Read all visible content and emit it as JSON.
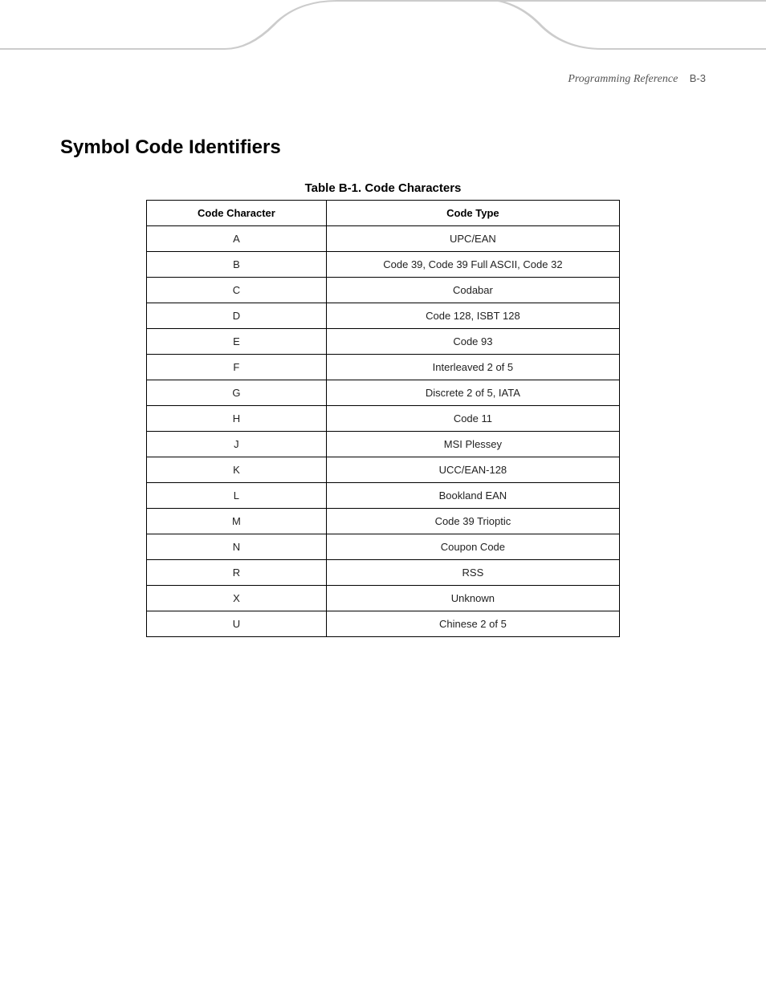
{
  "header": {
    "section": "Programming Reference",
    "page": "B-3"
  },
  "title": "Symbol Code Identifiers",
  "table_title": "Table B-1.  Code Characters",
  "columns": [
    "Code Character",
    "Code Type"
  ],
  "chart_data": {
    "type": "table",
    "title": "Code Characters",
    "columns": [
      "Code Character",
      "Code Type"
    ],
    "rows": [
      {
        "char": "A",
        "type": "UPC/EAN"
      },
      {
        "char": "B",
        "type": "Code 39, Code 39 Full ASCII, Code 32"
      },
      {
        "char": "C",
        "type": "Codabar"
      },
      {
        "char": "D",
        "type": "Code 128, ISBT 128"
      },
      {
        "char": "E",
        "type": "Code 93"
      },
      {
        "char": "F",
        "type": "Interleaved 2 of 5"
      },
      {
        "char": "G",
        "type": "Discrete 2 of 5, IATA"
      },
      {
        "char": "H",
        "type": "Code 11"
      },
      {
        "char": "J",
        "type": "MSI Plessey"
      },
      {
        "char": "K",
        "type": "UCC/EAN-128"
      },
      {
        "char": "L",
        "type": "Bookland EAN"
      },
      {
        "char": "M",
        "type": "Code 39 Trioptic"
      },
      {
        "char": "N",
        "type": "Coupon Code"
      },
      {
        "char": "R",
        "type": "RSS"
      },
      {
        "char": "X",
        "type": "Unknown"
      },
      {
        "char": "U",
        "type": "Chinese 2 of 5"
      }
    ]
  }
}
